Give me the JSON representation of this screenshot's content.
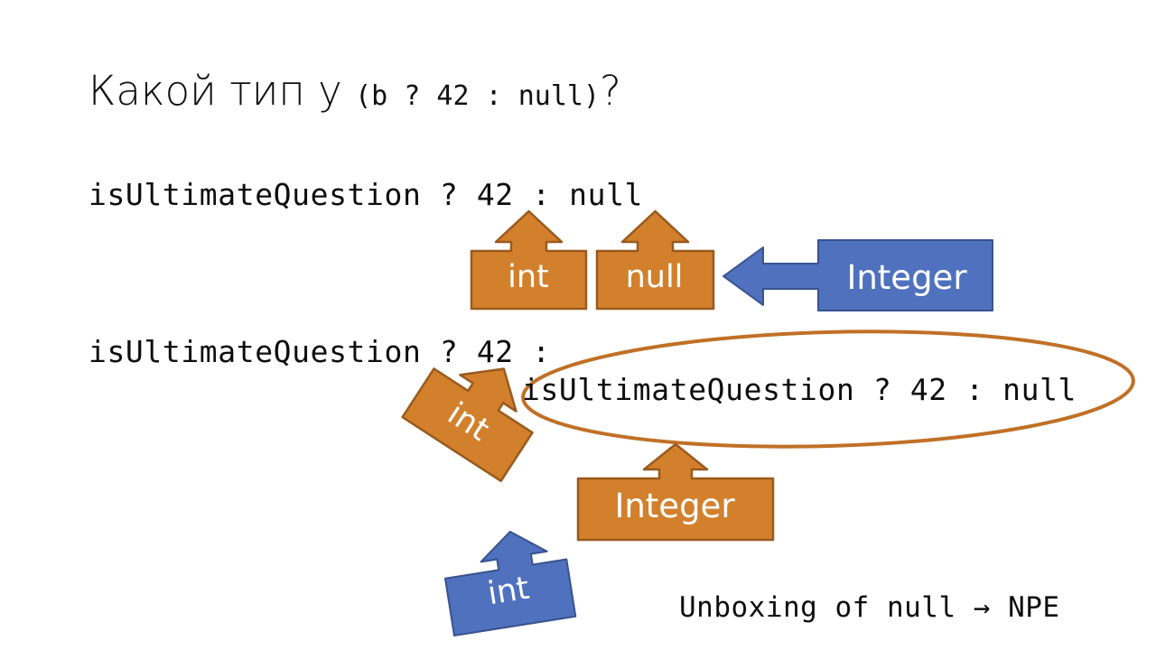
{
  "slide": {
    "background_color": "#ffffff",
    "title": {
      "prefix": "Какой тип у ",
      "code": "(b ? 42 : null)",
      "suffix": "?"
    },
    "code_lines": {
      "line1": "isUltimateQuestion ? 42 : null",
      "line2": "isUltimateQuestion ? 42 :",
      "line3": "isUltimateQuestion ? 42 : null"
    },
    "footer_note": "Unboxing of null → NPE",
    "callouts": [
      {
        "id": "int-1",
        "label": "int",
        "color": "#D2802C",
        "direction": "up",
        "note": "points at 42 in first line"
      },
      {
        "id": "null-1",
        "label": "null",
        "color": "#D2802C",
        "direction": "up",
        "note": "points at null in first line"
      },
      {
        "id": "integer-blue",
        "label": "Integer",
        "color": "#4F71BE",
        "direction": "left",
        "note": "points at the null callout"
      },
      {
        "id": "int-rot",
        "label": "int",
        "color": "#D2802C",
        "direction": "up",
        "note": "points at 42 in second line"
      },
      {
        "id": "integer-orange",
        "label": "Integer",
        "color": "#D2802C",
        "direction": "up",
        "note": "points at the nested expression"
      },
      {
        "id": "int-blue",
        "label": "int",
        "color": "#4F71BE",
        "direction": "up",
        "note": "points at the Integer callout"
      }
    ],
    "ellipse": {
      "stroke_color": "#C07026",
      "encloses": "isUltimateQuestion ? 42 : null"
    },
    "colors": {
      "orange": "#D2802C",
      "orange_border": "#9A5A1C",
      "blue": "#4F71BE",
      "blue_border": "#38538F",
      "text": "#0d0d0d",
      "callout_text": "#ffffff"
    }
  }
}
